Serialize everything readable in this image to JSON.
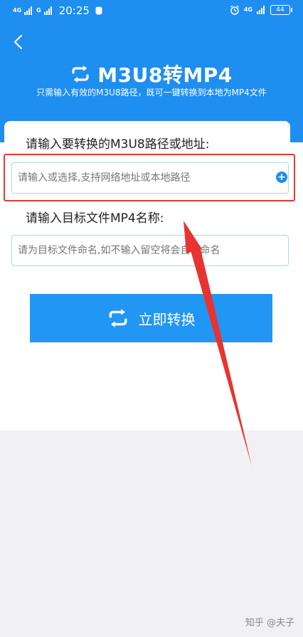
{
  "status_bar": {
    "network_left": "4G",
    "network_right_small": "G",
    "time": "20:25",
    "network_right": "4G",
    "battery": "44"
  },
  "header": {
    "title": "M3U8转MP4",
    "subtitle": "只需输入有效的M3U8路径，既可一键转换到本地为MP4文件",
    "title_icon": "convert-arrows-icon",
    "back_icon": "chevron-left-icon"
  },
  "form": {
    "source_label": "请输入要转换的M3U8路径或地址:",
    "source_placeholder": "请输入或选择,支持网络地址或本地路径",
    "source_value": "",
    "add_icon": "plus-circle-icon",
    "target_label": "请输入目标文件MP4名称:",
    "target_placeholder": "请为目标文件命名,如不输入留空将会自动命名",
    "target_value": "",
    "convert_label": "立即转换"
  },
  "colors": {
    "brand_blue": "#1e8ef0",
    "button_blue": "#2196f3",
    "annotation_red": "#e03b36"
  },
  "watermark": "知乎 @夫子"
}
